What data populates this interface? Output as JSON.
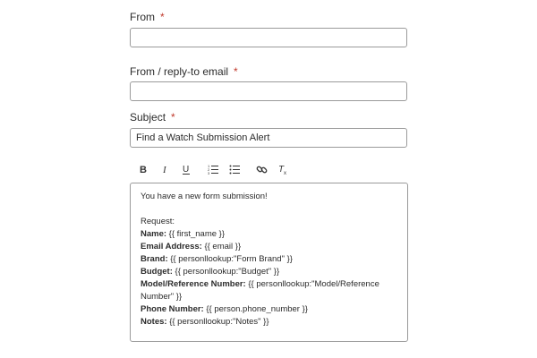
{
  "form": {
    "from": {
      "label": "From",
      "required_mark": "*",
      "value": ""
    },
    "reply_to": {
      "label": "From / reply-to email",
      "required_mark": "*",
      "value": ""
    },
    "subject": {
      "label": "Subject",
      "required_mark": "*",
      "value": "Find a Watch Submission Alert"
    }
  },
  "toolbar": {
    "icons": [
      "bold-icon",
      "italic-icon",
      "underline-icon",
      "ordered-list-icon",
      "bullet-list-icon",
      "link-icon",
      "clear-format-icon"
    ]
  },
  "editor": {
    "intro": "You have a new form submission!",
    "request_label": "Request:",
    "rows": [
      {
        "label": "Name:",
        "value": " {{ first_name }}"
      },
      {
        "label": "Email Address:",
        "value": " {{ email }}"
      },
      {
        "label": "Brand:",
        "value": " {{ personllookup:\"Form Brand\" }}"
      },
      {
        "label": "Budget:",
        "value": " {{ personllookup:\"Budget\" }}"
      },
      {
        "label": "Model/Reference Number:",
        "value": " {{ personllookup:\"Model/Reference Number\" }}"
      },
      {
        "label": "Phone Number:",
        "value": " {{ person.phone_number }}"
      },
      {
        "label": "Notes:",
        "value": " {{ personllookup:\"Notes\" }}"
      }
    ]
  }
}
